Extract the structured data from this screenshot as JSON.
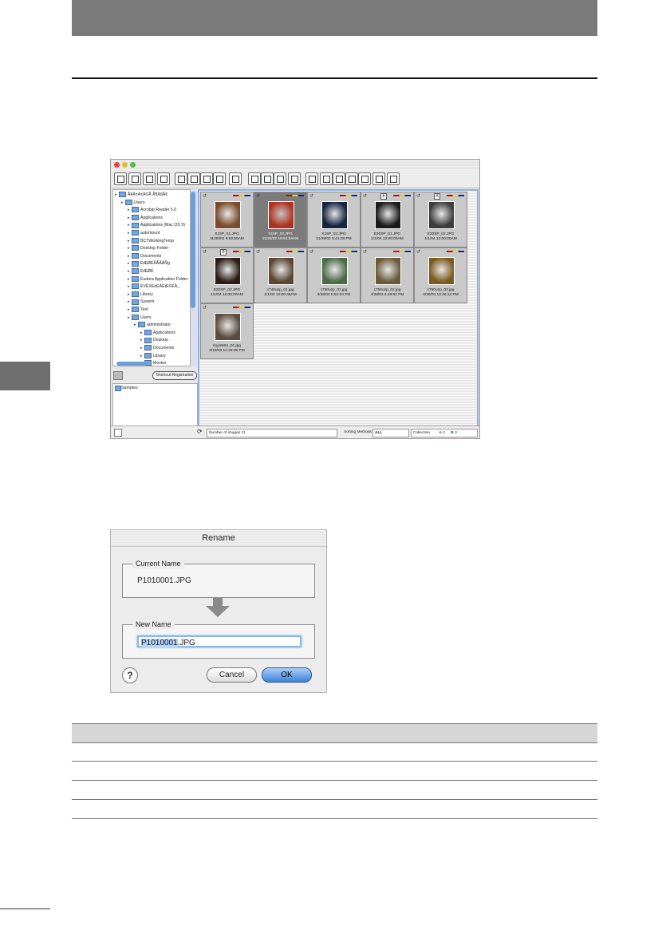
{
  "tree": {
    "items": [
      {
        "label": "Ã¥Ä±Â±Â©Ã Ã¶Â§Ã¢",
        "depth": 0
      },
      {
        "label": "Users",
        "depth": 1
      },
      {
        "label": "Acrobat Reader 5.0",
        "depth": 2
      },
      {
        "label": "Applications",
        "depth": 2
      },
      {
        "label": "Applications (Mac OS 9)",
        "depth": 2
      },
      {
        "label": "automount",
        "depth": 2
      },
      {
        "label": "BCTWorkingTemp",
        "depth": 2
      },
      {
        "label": "Desktop Folder",
        "depth": 2
      },
      {
        "label": "Documents",
        "depth": 2
      },
      {
        "label": "ÐÆØÉÅÃÅÂÑg",
        "depth": 2
      },
      {
        "label": "ÐÆØÉ",
        "depth": 2
      },
      {
        "label": "Eudora Application Folder",
        "depth": 2
      },
      {
        "label": "ÉVÉXÉeÉÄÉtÉ©ÉÅ_",
        "depth": 2
      },
      {
        "label": "Library",
        "depth": 2
      },
      {
        "label": "System",
        "depth": 2
      },
      {
        "label": "Test",
        "depth": 2
      },
      {
        "label": "Users",
        "depth": 2
      },
      {
        "label": "administrator",
        "depth": 3
      },
      {
        "label": "Applications",
        "depth": 4
      },
      {
        "label": "Desktop",
        "depth": 4
      },
      {
        "label": "Documents",
        "depth": 4
      },
      {
        "label": "Library",
        "depth": 4
      },
      {
        "label": "Movies",
        "depth": 4
      }
    ],
    "register_button": "Shortcut Registration",
    "favorite": "Samples"
  },
  "thumbnails": [
    {
      "caption": "X15P_01.JPG\n11/30/02 9:52:50AM",
      "color": "#7a4a2a",
      "mark": "",
      "selected": false
    },
    {
      "caption": "X15P_02.JPG\n11/30/02 10:52:54AM",
      "color": "#b0331f",
      "mark": "",
      "selected": true
    },
    {
      "caption": "X15P_03.JPG\n11/29/02 5:41:28 PM",
      "color": "#14233f",
      "mark": "",
      "selected": false
    },
    {
      "caption": "E20SP_01.JPG\n1/1/04 12:00:00AM",
      "color": "#1a1a1a",
      "mark": "A",
      "selected": false
    },
    {
      "caption": "E20SP_02.JPG\n1/1/04 12:00:00AM",
      "color": "#3c3c3c",
      "mark": "A",
      "selected": false
    },
    {
      "caption": "E20SP_03.JPG\n1/1/04 12:00:00AM",
      "color": "#2b1d16",
      "mark": "B",
      "selected": false
    },
    {
      "caption": "c740uzp_01.jpg\n1/1/03 12:00:46AM",
      "color": "#5a4632",
      "mark": "",
      "selected": false
    },
    {
      "caption": "c750uzp_01.jpg\n4/28/03 5:51:04 PM",
      "color": "#4c6a48",
      "mark": "",
      "selected": false
    },
    {
      "caption": "c750uzp_02.jpg\n4/28/03 4:49:52 PM",
      "color": "#6a5a3a",
      "mark": "",
      "selected": false
    },
    {
      "caption": "c750uzp_03.jpg\n4/30/03 12:46:13 PM",
      "color": "#7a5a1f",
      "mark": "",
      "selected": false
    },
    {
      "caption": "myjo5sto_01.jpg\n3/19/03 12:26:05 PM",
      "color": "#5b4a3e",
      "mark": "",
      "selected": false
    }
  ],
  "status": {
    "count": "Number of images 11",
    "sort": "Sorting Methods",
    "sort_value": "ALL",
    "collection": "Collection",
    "coll_a": "2",
    "coll_b": "3"
  },
  "dialog": {
    "title": "Rename",
    "current_label": "Current Name",
    "current_value": "P1010001.JPG",
    "new_label": "New Name",
    "new_value_selected": "P1010001",
    "new_value_ext": ".JPG",
    "help": "?",
    "cancel": "Cancel",
    "ok": "OK"
  }
}
